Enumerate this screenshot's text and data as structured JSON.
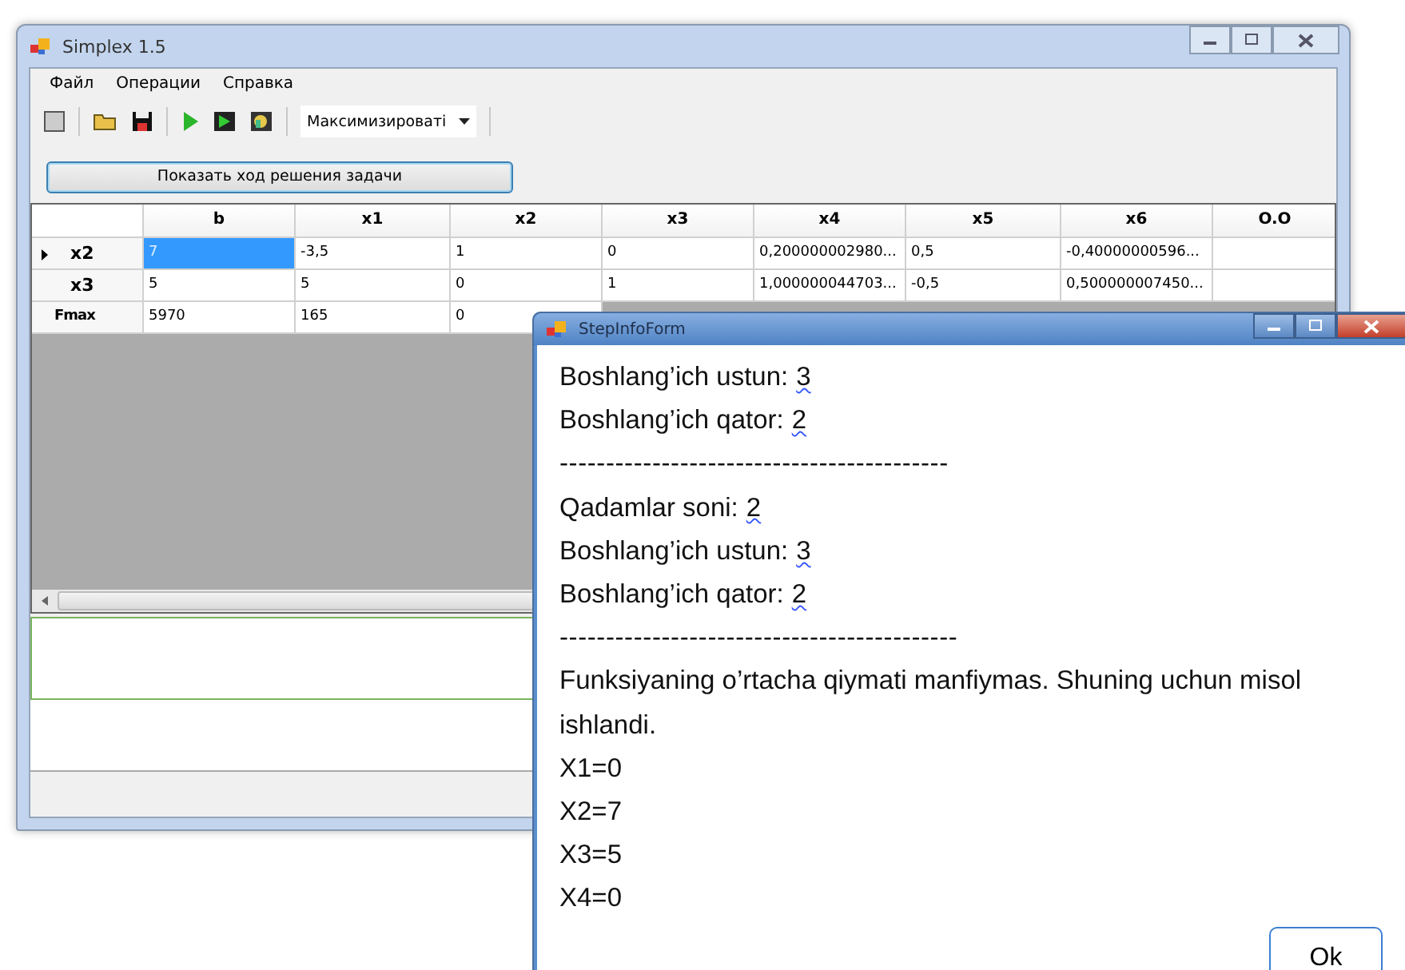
{
  "main_window": {
    "title": "Simplex 1.5",
    "menu": [
      "Файл",
      "Операции",
      "Справка"
    ],
    "toolbar": {
      "dropdown": "Максимизироваті"
    },
    "solve_button": "Показать ход решения задачи",
    "grid": {
      "columns": [
        "b",
        "x1",
        "x2",
        "x3",
        "x4",
        "x5",
        "x6",
        "O.O"
      ],
      "rows": [
        {
          "header": "x2",
          "current": true,
          "cells": [
            {
              "text": "7",
              "selected": true
            },
            {
              "text": "-3,5",
              "selected": false
            },
            {
              "text": "1",
              "selected": false
            },
            {
              "text": "0",
              "selected": false
            },
            {
              "text": "0,200000002980...",
              "selected": false
            },
            {
              "text": "0,5",
              "selected": false
            },
            {
              "text": "-0,40000000596...",
              "selected": false
            },
            {
              "text": "",
              "selected": false
            }
          ]
        },
        {
          "header": "x3",
          "current": false,
          "cells": [
            {
              "text": "5",
              "selected": false
            },
            {
              "text": "5",
              "selected": false
            },
            {
              "text": "0",
              "selected": false
            },
            {
              "text": "1",
              "selected": false
            },
            {
              "text": "1,000000044703...",
              "selected": false
            },
            {
              "text": "-0,5",
              "selected": false
            },
            {
              "text": "0,500000007450...",
              "selected": false
            },
            {
              "text": "",
              "selected": false
            }
          ]
        },
        {
          "header": "Fmax",
          "current": false,
          "cells": [
            {
              "text": "5970",
              "selected": false
            },
            {
              "text": "165",
              "selected": false
            },
            {
              "text": "0",
              "selected": false
            }
          ]
        }
      ]
    }
  },
  "dialog": {
    "title": "StepInfoForm",
    "lines": [
      {
        "kind": "pair",
        "label": "Boshlang’ich ustun:",
        "value": "3"
      },
      {
        "kind": "pair",
        "label": "Boshlang’ich qator:",
        "value": "2"
      },
      {
        "kind": "rule",
        "text": "------------------------------------------"
      },
      {
        "kind": "pair",
        "label": "Qadamlar soni:",
        "value": "2"
      },
      {
        "kind": "pair",
        "label": "Boshlang’ich ustun:",
        "value": "3"
      },
      {
        "kind": "pair",
        "label": "Boshlang’ich qator:",
        "value": "2"
      },
      {
        "kind": "rule",
        "text": "-------------------------------------------"
      },
      {
        "kind": "text",
        "text": "Funksiyaning o’rtacha qiymati manfiymas. Shuning uchun misol ishlandi."
      },
      {
        "kind": "text",
        "text": "X1=0"
      },
      {
        "kind": "text",
        "text": "X2=7"
      },
      {
        "kind": "text",
        "text": "X3=5"
      },
      {
        "kind": "text",
        "text": "X4=0"
      }
    ],
    "ok_button": "Ok"
  }
}
